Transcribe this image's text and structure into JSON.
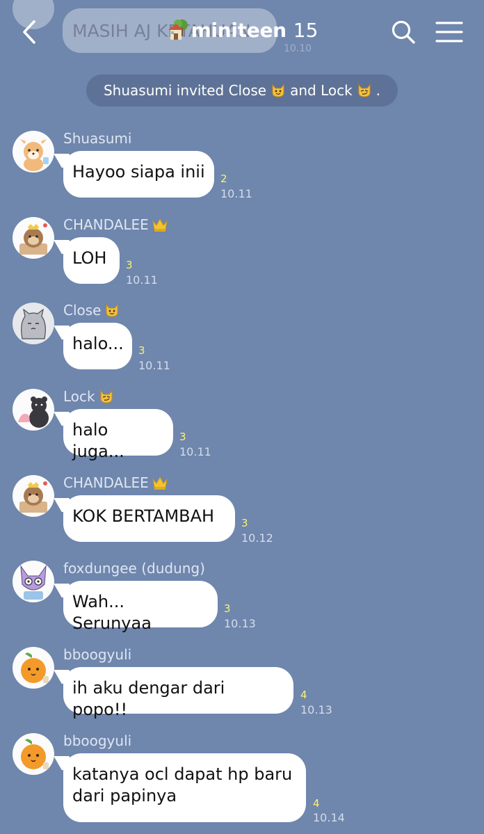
{
  "header": {
    "ghost_message": "MASIH AJ KETAHUAN",
    "ghost_time": "10.10",
    "title": "miniteen",
    "member_count": "15",
    "house_icon": "house-with-tree-icon",
    "back_icon": "chevron-left-icon",
    "search_icon": "search-icon",
    "menu_icon": "hamburger-menu-icon"
  },
  "notice": {
    "part1": "Shuasumi invited Close",
    "part2": "and Lock",
    "part3": "."
  },
  "messages": [
    {
      "sender": "Shuasumi",
      "text": "Hayoo siapa inii",
      "read": "2",
      "time": "10.11",
      "avatar": "deer-avatar"
    },
    {
      "sender": "CHANDALEE",
      "text": "LOH",
      "read": "3",
      "time": "10.11",
      "avatar": "otter-avatar",
      "crown": true
    },
    {
      "sender": "Close",
      "text": "halo...",
      "read": "3",
      "time": "10.11",
      "avatar": "grey-cat-avatar",
      "cat": "smile"
    },
    {
      "sender": "Lock",
      "text": "halo juga...",
      "read": "3",
      "time": "10.11",
      "avatar": "black-bear-avatar",
      "cat": "smirk"
    },
    {
      "sender": "CHANDALEE",
      "text": "KOK BERTAMBAH",
      "read": "3",
      "time": "10.12",
      "avatar": "otter-avatar",
      "crown": true
    },
    {
      "sender": "foxdungee (dudung)",
      "text": "Wah... Serunyaa",
      "read": "3",
      "time": "10.13",
      "avatar": "fox-avatar"
    },
    {
      "sender": "bboogyuli",
      "text": "ih aku dengar dari popo!!",
      "read": "4",
      "time": "10.13",
      "avatar": "orange-avatar"
    },
    {
      "sender": "bboogyuli",
      "text": "katanya ocl dapat hp baru\ndari papinya",
      "read": "4",
      "time": "10.14",
      "avatar": "orange-avatar"
    }
  ],
  "colors": {
    "background": "#6f86ad",
    "notice_background": "#5d7296",
    "bubble": "#ffffff",
    "read_count": "#fff36b"
  }
}
